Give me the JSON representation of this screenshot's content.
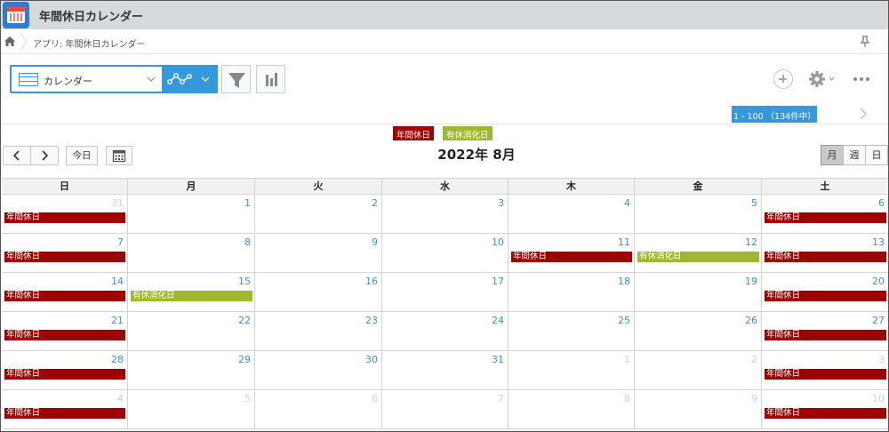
{
  "app": {
    "title": "年間休日カレンダー"
  },
  "breadcrumb": {
    "text": "アプリ: 年間休日カレンダー"
  },
  "toolbar": {
    "view_name": "カレンダー"
  },
  "pager": {
    "text": "1 - 100 （134件中）"
  },
  "legend": [
    {
      "label": "年間休日",
      "color": "#a00000"
    },
    {
      "label": "有休消化日",
      "color": "#a0b830"
    }
  ],
  "nav": {
    "prev": "<",
    "next": ">",
    "today": "今日"
  },
  "month_title": "2022年 8月",
  "view_modes": {
    "month": "月",
    "week": "週",
    "day": "日",
    "active": "month"
  },
  "weekdays": [
    "日",
    "月",
    "火",
    "水",
    "木",
    "金",
    "土"
  ],
  "weeks": [
    [
      {
        "n": "31",
        "other": true,
        "event": "年間休日",
        "color": "red"
      },
      {
        "n": "1"
      },
      {
        "n": "2"
      },
      {
        "n": "3"
      },
      {
        "n": "4"
      },
      {
        "n": "5"
      },
      {
        "n": "6",
        "event": "年間休日",
        "color": "red"
      }
    ],
    [
      {
        "n": "7",
        "event": "年間休日",
        "color": "red"
      },
      {
        "n": "8"
      },
      {
        "n": "9"
      },
      {
        "n": "10"
      },
      {
        "n": "11",
        "event": "年間休日",
        "color": "red"
      },
      {
        "n": "12",
        "event": "有休消化日",
        "color": "green"
      },
      {
        "n": "13",
        "event": "年間休日",
        "color": "red"
      }
    ],
    [
      {
        "n": "14",
        "event": "年間休日",
        "color": "red"
      },
      {
        "n": "15",
        "event": "有休消化日",
        "color": "green"
      },
      {
        "n": "16"
      },
      {
        "n": "17"
      },
      {
        "n": "18"
      },
      {
        "n": "19"
      },
      {
        "n": "20",
        "event": "年間休日",
        "color": "red"
      }
    ],
    [
      {
        "n": "21",
        "event": "年間休日",
        "color": "red"
      },
      {
        "n": "22"
      },
      {
        "n": "23"
      },
      {
        "n": "24"
      },
      {
        "n": "25"
      },
      {
        "n": "26"
      },
      {
        "n": "27",
        "event": "年間休日",
        "color": "red"
      }
    ],
    [
      {
        "n": "28",
        "event": "年間休日",
        "color": "red"
      },
      {
        "n": "29"
      },
      {
        "n": "30"
      },
      {
        "n": "31"
      },
      {
        "n": "1",
        "other": true
      },
      {
        "n": "2",
        "other": true
      },
      {
        "n": "3",
        "other": true,
        "event": "年間休日",
        "color": "red"
      }
    ],
    [
      {
        "n": "4",
        "other": true,
        "event": "年間休日",
        "color": "red"
      },
      {
        "n": "5",
        "other": true
      },
      {
        "n": "6",
        "other": true
      },
      {
        "n": "7",
        "other": true
      },
      {
        "n": "8",
        "other": true
      },
      {
        "n": "9",
        "other": true
      },
      {
        "n": "10",
        "other": true,
        "event": "年間休日",
        "color": "red"
      }
    ]
  ]
}
